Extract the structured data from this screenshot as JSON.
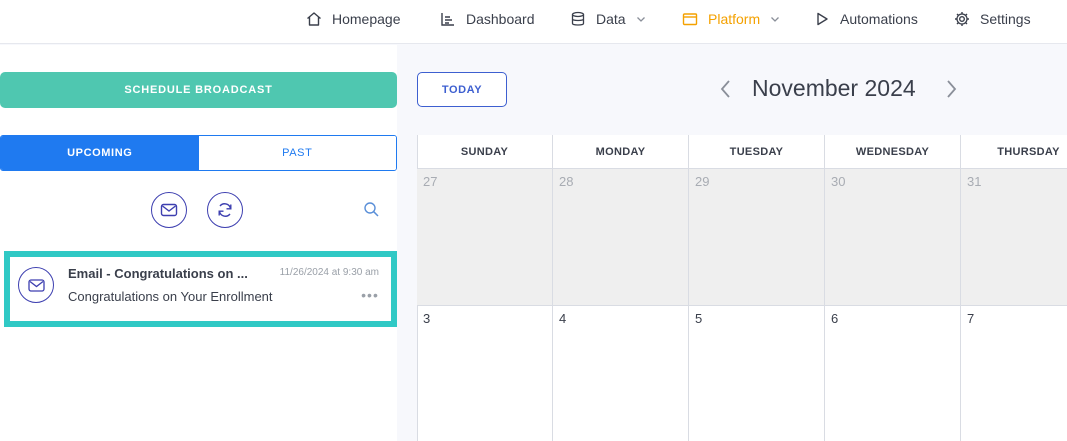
{
  "nav": {
    "items": [
      {
        "label": "Homepage",
        "icon": "home-icon"
      },
      {
        "label": "Dashboard",
        "icon": "dashboard-icon"
      },
      {
        "label": "Data",
        "icon": "database-icon",
        "dropdown": true
      },
      {
        "label": "Platform",
        "icon": "folder-icon",
        "dropdown": true,
        "active": true
      },
      {
        "label": "Automations",
        "icon": "play-icon"
      },
      {
        "label": "Settings",
        "icon": "gear-icon"
      }
    ],
    "active_color": "#f4a100"
  },
  "sidebar": {
    "schedule_label": "SCHEDULE BROADCAST",
    "tabs": {
      "upcoming": "UPCOMING",
      "past": "PAST"
    },
    "icons": {
      "email": "envelope-icon",
      "refresh": "refresh-icon",
      "search": "search-icon"
    },
    "messages": [
      {
        "title": "Email - Congratulations on ...",
        "date": "11/26/2024 at 9:30 am",
        "subject": "Congratulations on Your Enrollment",
        "icon": "envelope-icon",
        "more": "•••"
      }
    ]
  },
  "calendar": {
    "today_label": "TODAY",
    "month": "November 2024",
    "weekdays": [
      "SUNDAY",
      "MONDAY",
      "TUESDAY",
      "WEDNESDAY",
      "THURSDAY"
    ],
    "weeks": [
      [
        {
          "day": "27",
          "other": true
        },
        {
          "day": "28",
          "other": true
        },
        {
          "day": "29",
          "other": true
        },
        {
          "day": "30",
          "other": true
        },
        {
          "day": "31",
          "other": true
        }
      ],
      [
        {
          "day": "3",
          "other": false
        },
        {
          "day": "4",
          "other": false
        },
        {
          "day": "5",
          "other": false
        },
        {
          "day": "6",
          "other": false
        },
        {
          "day": "7",
          "other": false
        }
      ]
    ]
  },
  "colors": {
    "accent_teal": "#4fc7b0",
    "tab_blue": "#1f7af0",
    "highlight": "#30c9c5",
    "icon_indigo": "#3d3fb0"
  }
}
